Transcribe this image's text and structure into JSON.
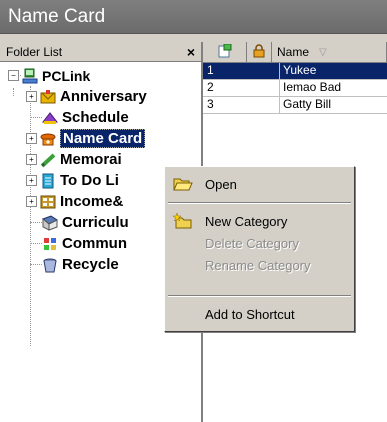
{
  "window": {
    "title": "Name Card"
  },
  "folder_panel": {
    "title": "Folder List",
    "close_glyph": "×",
    "tree": [
      {
        "label": "PCLink",
        "icon": "computer-icon"
      },
      {
        "label": "Anniversary",
        "icon": "anniversary-icon"
      },
      {
        "label": "Schedule",
        "icon": "schedule-icon"
      },
      {
        "label": "Name Card",
        "icon": "phone-icon",
        "selected": true
      },
      {
        "label": "Memorai",
        "icon": "memo-icon"
      },
      {
        "label": "To Do Li",
        "icon": "todo-icon"
      },
      {
        "label": "Income&",
        "icon": "income-icon"
      },
      {
        "label": "Curriculu",
        "icon": "curriculum-icon"
      },
      {
        "label": "Commun",
        "icon": "communication-icon"
      },
      {
        "label": "Recycle",
        "icon": "recycle-icon"
      }
    ]
  },
  "list": {
    "columns": {
      "name": "Name"
    },
    "rows": [
      {
        "num": "1",
        "name": "Yukee",
        "selected": true
      },
      {
        "num": "2",
        "name": "Iemao Bad"
      },
      {
        "num": "3",
        "name": "Gatty Bill"
      }
    ]
  },
  "context_menu": {
    "items": [
      {
        "label": "Open",
        "enabled": true,
        "icon": "folder-open-icon"
      },
      {
        "label": "New Category",
        "enabled": true,
        "icon": "new-folder-icon"
      },
      {
        "label": "Delete Category",
        "enabled": false
      },
      {
        "label": "Rename Category",
        "enabled": false
      },
      {
        "label": "Add to Shortcut",
        "enabled": true
      }
    ]
  },
  "colors": {
    "selection": "#0a246a",
    "chrome": "#d4d0c8",
    "title_bar": "#737373"
  }
}
